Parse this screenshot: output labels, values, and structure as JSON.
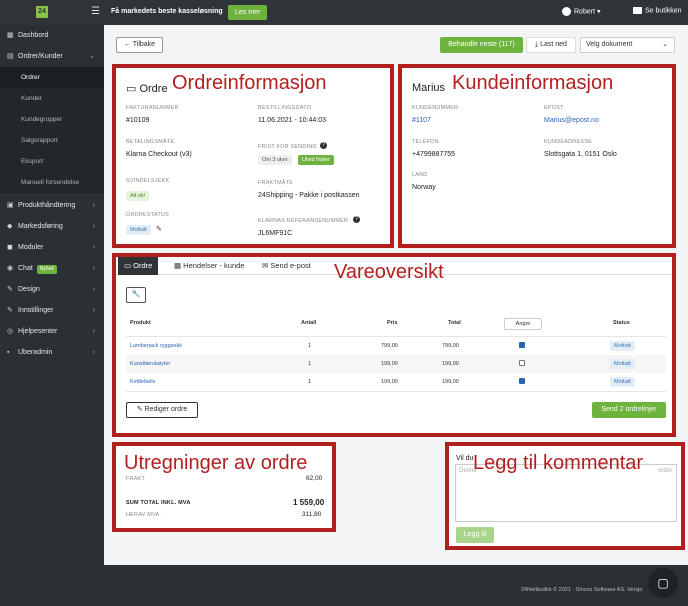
{
  "topbar": {
    "logo": "24",
    "promo": "Få markedets beste kasseløsning",
    "promo_button": "Les mer",
    "user": "Robert",
    "shop": "Se butikken"
  },
  "sidebar": {
    "items": [
      {
        "label": "Dashbord",
        "icon": "dashboard-icon",
        "glyph": "▦"
      },
      {
        "label": "Ordrer/Kunder",
        "icon": "orders-icon",
        "glyph": "▤"
      },
      {
        "label": "Produkthåndtering",
        "icon": "products-icon",
        "glyph": "▣"
      },
      {
        "label": "Markedsføring",
        "icon": "megaphone-icon",
        "glyph": "◆"
      },
      {
        "label": "Moduler",
        "icon": "modules-icon",
        "glyph": "◼"
      },
      {
        "label": "Chat",
        "icon": "chat-icon",
        "glyph": "◉",
        "badge": "Nyhet!"
      },
      {
        "label": "Design",
        "icon": "design-icon",
        "glyph": "✎"
      },
      {
        "label": "Innstillinger",
        "icon": "settings-icon",
        "glyph": "✎"
      },
      {
        "label": "Hjelpesenter",
        "icon": "help-icon",
        "glyph": "◎"
      },
      {
        "label": "Uberadmin",
        "icon": "lock-icon",
        "glyph": "▪"
      }
    ],
    "subitems": [
      "Ordrer",
      "Kunder",
      "Kundegrupper",
      "Salgsrapport",
      "Eksport",
      "Manuell forsendelse"
    ]
  },
  "toolbar": {
    "back": "Tilbake",
    "process_next": "Behandle neste (117)",
    "download": "Last ned",
    "select_doc": "Velg dokument"
  },
  "order": {
    "title": "Ordre",
    "overlay": "Ordreinformasjon",
    "invoice_label": "FAKTURANUMMER",
    "invoice": "#10109",
    "date_label": "BESTILLINGSDATO",
    "date": "11.06.2021 - 10:44:03",
    "payment_label": "BETALINGSMÅTE",
    "payment": "Klarna Checkout (v3)",
    "deadline_label": "FRIST FOR SENDING",
    "deadline_pill": "Om 3 uker",
    "deadline_btn": "Utvid frister",
    "fraud_label": "SVINDELSJEKK",
    "fraud": "Alt ok!",
    "shipping_label": "FRAKTMÅTE",
    "shipping": "24Shipping - Pakke i postkassen",
    "status_label": "ORDRESTATUS",
    "status": "Mottatt",
    "klarna_label": "KLARNAS REFERANSENUMMER",
    "klarna": "JL6MF91C"
  },
  "customer": {
    "name": "Marius",
    "overlay": "Kundeinformasjon",
    "custno_label": "KUNDENUMMER",
    "custno": "#1107",
    "email_label": "EPOST",
    "email": "Marius@epost.no",
    "phone_label": "TELEFON",
    "phone": "+4799887755",
    "address_label": "KUNDEADRESSE",
    "address": "Slottsgata 1, 0151 Oslo",
    "country_label": "LAND",
    "country": "Norway"
  },
  "products": {
    "overlay": "Vareoversikt",
    "tabs": [
      "Ordre",
      "Hendelser - kunde",
      "Send e-post"
    ],
    "headers": {
      "product": "Produkt",
      "qty": "Antall",
      "price": "Pris",
      "total": "Total",
      "undo": "Angre",
      "status": "Status"
    },
    "rows": [
      {
        "name": "Lumberjack ryggsekk",
        "qty": "1",
        "price": "799,00",
        "total": "799,00",
        "checked": true,
        "status": "Mottatt"
      },
      {
        "name": "Kunstlærsbøyter",
        "qty": "1",
        "price": "199,00",
        "total": "199,00",
        "checked": false,
        "status": "Mottatt"
      },
      {
        "name": "Kettlebells",
        "qty": "1",
        "price": "199,00",
        "total": "199,00",
        "checked": true,
        "status": "Mottatt"
      }
    ],
    "edit": "Rediger ordre",
    "send": "Send 2 ordrelinjer"
  },
  "totals": {
    "overlay": "Utregninger av ordre",
    "freight_label": "FRAKT",
    "freight": "62,00",
    "sum_label": "SUM TOTAL INKL. MVA",
    "sum": "1 559,00",
    "vat_label": "HERAV MVA.",
    "vat": "311,80"
  },
  "comment": {
    "overlay": "Legg til kommentar",
    "label": "Vil du",
    "placeholder": "Denne",
    "placeholder_right": "ordre",
    "button": "Legg til"
  },
  "footer": {
    "text": "24Nettbutikk © 2021 · Sincos Software AS. Versjo"
  }
}
